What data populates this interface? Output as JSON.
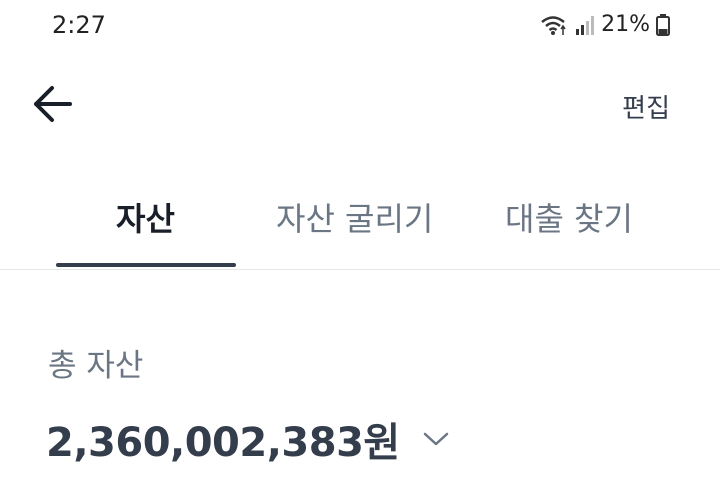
{
  "status_bar": {
    "time": "2:27",
    "battery": "21%",
    "icons": [
      "wifi-icon",
      "signal-icon",
      "battery-icon"
    ]
  },
  "header": {
    "back_icon": "arrow-left-icon",
    "edit_label": "편집"
  },
  "tabs": [
    {
      "label": "자산",
      "active": true
    },
    {
      "label": "자산 굴리기",
      "active": false
    },
    {
      "label": "대출 찾기",
      "active": false
    }
  ],
  "summary": {
    "label": "총 자산",
    "value": "2,360,002,383원",
    "toggle_icon": "chevron-down-icon"
  },
  "colors": {
    "text_primary": "#191f28",
    "text_secondary": "#6b7684",
    "indicator": "#333d4b",
    "divider": "#e5e8eb"
  }
}
